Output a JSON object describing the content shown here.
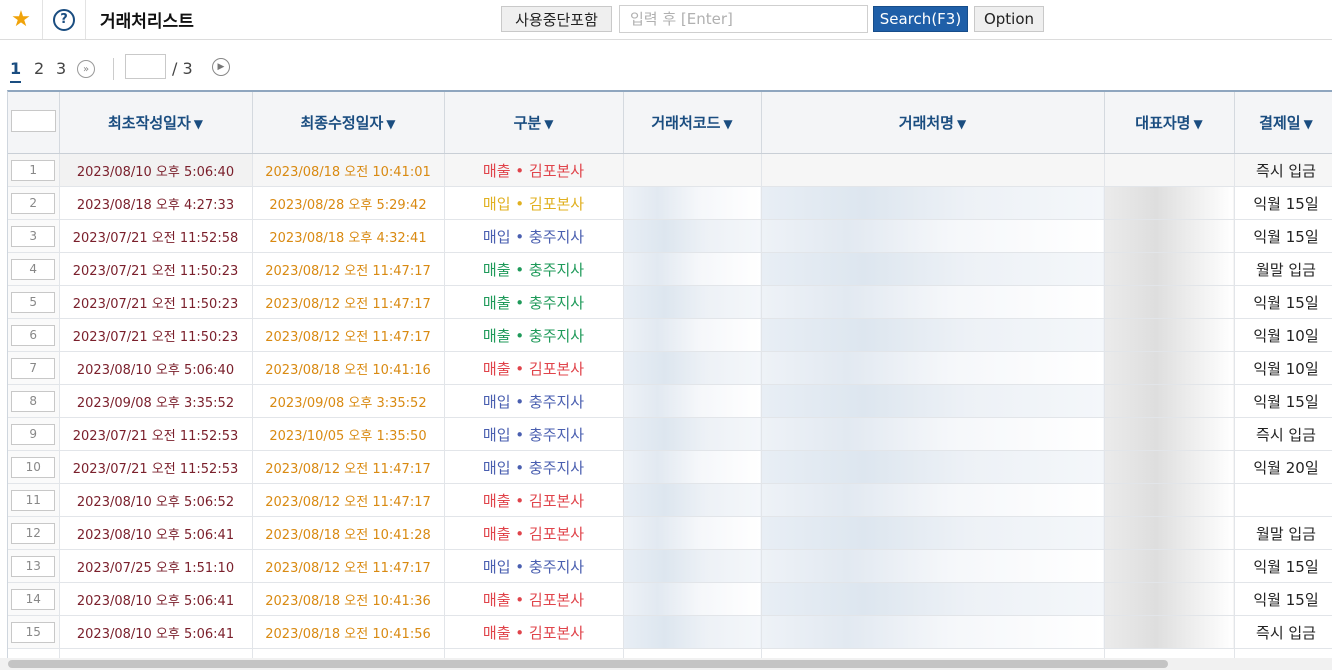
{
  "toolbar": {
    "title": "거래처리스트",
    "inactive_label": "사용중단포함",
    "search_placeholder": "입력 후 [Enter]",
    "search_label": "Search(F3)",
    "option_label": "Option"
  },
  "pager": {
    "pages": [
      "1",
      "2",
      "3"
    ],
    "current": "1",
    "next_icon": "»",
    "total": "/ 3"
  },
  "columns": [
    "최초작성일자",
    "최종수정일자",
    "구분",
    "거래처코드",
    "거래처명",
    "대표자명",
    "결제일"
  ],
  "sort_arrow": "▼",
  "colors": {
    "accent": "#1f5fa8",
    "header_text": "#1a4d80",
    "star": "#f0a30a"
  },
  "rows": [
    {
      "no": "1",
      "created": "2023/08/10 오후 5:06:40",
      "updated": "2023/08/18 오전 10:41:01",
      "division": "매출 • 김포본사",
      "color": "red",
      "pay": "즉시 입금"
    },
    {
      "no": "2",
      "created": "2023/08/18 오후 4:27:33",
      "updated": "2023/08/28 오후 5:29:42",
      "division": "매입 • 김포본사",
      "color": "yellow",
      "pay": "익월 15일"
    },
    {
      "no": "3",
      "created": "2023/07/21 오전 11:52:58",
      "updated": "2023/08/18 오후 4:32:41",
      "division": "매입 • 충주지사",
      "color": "blue",
      "pay": "익월 15일"
    },
    {
      "no": "4",
      "created": "2023/07/21 오전 11:50:23",
      "updated": "2023/08/12 오전 11:47:17",
      "division": "매출 • 충주지사",
      "color": "green",
      "pay": "월말 입금"
    },
    {
      "no": "5",
      "created": "2023/07/21 오전 11:50:23",
      "updated": "2023/08/12 오전 11:47:17",
      "division": "매출 • 충주지사",
      "color": "green",
      "pay": "익월 15일"
    },
    {
      "no": "6",
      "created": "2023/07/21 오전 11:50:23",
      "updated": "2023/08/12 오전 11:47:17",
      "division": "매출 • 충주지사",
      "color": "green",
      "pay": "익월 10일"
    },
    {
      "no": "7",
      "created": "2023/08/10 오후 5:06:40",
      "updated": "2023/08/18 오전 10:41:16",
      "division": "매출 • 김포본사",
      "color": "red",
      "pay": "익월 10일"
    },
    {
      "no": "8",
      "created": "2023/09/08 오후 3:35:52",
      "updated": "2023/09/08 오후 3:35:52",
      "division": "매입 • 충주지사",
      "color": "blue",
      "pay": "익월 15일"
    },
    {
      "no": "9",
      "created": "2023/07/21 오전 11:52:53",
      "updated": "2023/10/05 오후 1:35:50",
      "division": "매입 • 충주지사",
      "color": "blue",
      "pay": "즉시 입금"
    },
    {
      "no": "10",
      "created": "2023/07/21 오전 11:52:53",
      "updated": "2023/08/12 오전 11:47:17",
      "division": "매입 • 충주지사",
      "color": "blue",
      "pay": "익월 20일"
    },
    {
      "no": "11",
      "created": "2023/08/10 오후 5:06:52",
      "updated": "2023/08/12 오전 11:47:17",
      "division": "매출 • 김포본사",
      "color": "red",
      "pay": ""
    },
    {
      "no": "12",
      "created": "2023/08/10 오후 5:06:41",
      "updated": "2023/08/18 오전 10:41:28",
      "division": "매출 • 김포본사",
      "color": "red",
      "pay": "월말 입금"
    },
    {
      "no": "13",
      "created": "2023/07/25 오후 1:51:10",
      "updated": "2023/08/12 오전 11:47:17",
      "division": "매입 • 충주지사",
      "color": "blue",
      "pay": "익월 15일"
    },
    {
      "no": "14",
      "created": "2023/08/10 오후 5:06:41",
      "updated": "2023/08/18 오전 10:41:36",
      "division": "매출 • 김포본사",
      "color": "red",
      "pay": "익월 15일"
    },
    {
      "no": "15",
      "created": "2023/08/10 오후 5:06:41",
      "updated": "2023/08/18 오전 10:41:56",
      "division": "매출 • 김포본사",
      "color": "red",
      "pay": "즉시 입금"
    }
  ]
}
